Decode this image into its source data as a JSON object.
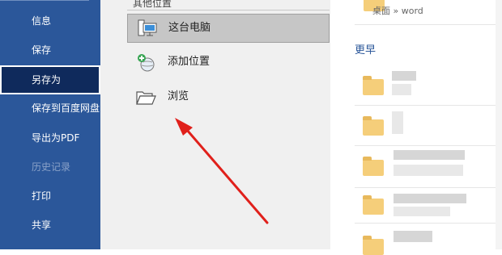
{
  "nav": {
    "items": [
      {
        "label": "信息",
        "state": "normal"
      },
      {
        "label": "保存",
        "state": "normal"
      },
      {
        "label": "另存为",
        "state": "selected"
      },
      {
        "label": "保存到百度网盘",
        "state": "normal"
      },
      {
        "label": "导出为PDF",
        "state": "normal"
      },
      {
        "label": "历史记录",
        "state": "disabled"
      },
      {
        "label": "打印",
        "state": "normal"
      },
      {
        "label": "共享",
        "state": "normal"
      }
    ]
  },
  "locations": {
    "header": "其他位置",
    "items": [
      {
        "label": "这台电脑",
        "icon": "computer-icon",
        "selected": true
      },
      {
        "label": "添加位置",
        "icon": "add-location-icon",
        "selected": false
      },
      {
        "label": "浏览",
        "icon": "folder-open-icon",
        "selected": false
      }
    ]
  },
  "recent": {
    "top_item_path": "桌面 » word",
    "section_label": "更早"
  },
  "colors": {
    "nav_bg": "#2b579a",
    "nav_selected": "#0f2a5c",
    "pane_bg": "#f0f0f0",
    "arrow": "#e0201b",
    "folder": "#f5ce7a"
  }
}
